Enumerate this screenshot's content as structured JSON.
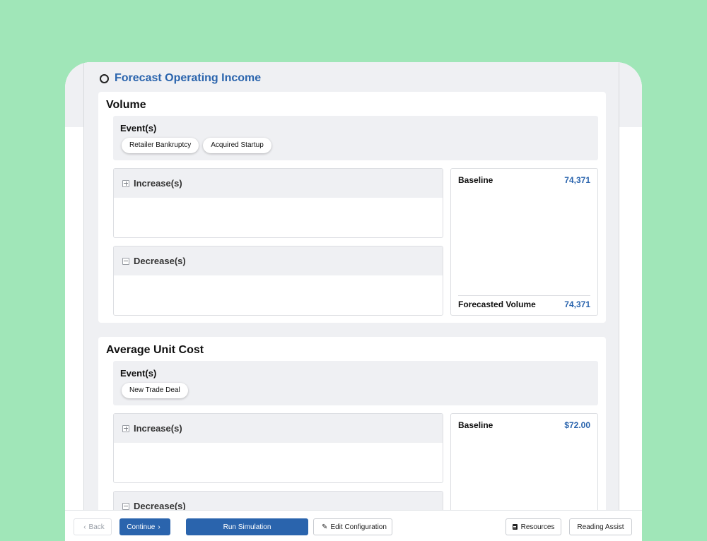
{
  "step": {
    "title": "Forecast Operating Income"
  },
  "volume": {
    "title": "Volume",
    "events_label": "Event(s)",
    "events": [
      "Retailer Bankruptcy",
      "Acquired Startup"
    ],
    "increase_label": "Increase(s)",
    "decrease_label": "Decrease(s)",
    "baseline_label": "Baseline",
    "baseline_value": "74,371",
    "forecast_label": "Forecasted Volume",
    "forecast_value": "74,371"
  },
  "unit_cost": {
    "title": "Average Unit Cost",
    "events_label": "Event(s)",
    "events": [
      "New Trade Deal"
    ],
    "increase_label": "Increase(s)",
    "decrease_label": "Decrease(s)",
    "baseline_label": "Baseline",
    "baseline_value": "$72.00"
  },
  "footer": {
    "back": "Back",
    "continue": "Continue",
    "run": "Run Simulation",
    "edit": "Edit Configuration",
    "resources": "Resources",
    "reading_assist": "Reading Assist"
  },
  "colors": {
    "accent": "#2a64ad",
    "background": "#a0e6b8",
    "panel": "#eff0f3"
  },
  "icons": [
    "circle-step-icon",
    "plus-square-icon",
    "minus-square-icon",
    "chevron-left-icon",
    "chevron-right-icon",
    "pencil-icon",
    "document-icon"
  ]
}
